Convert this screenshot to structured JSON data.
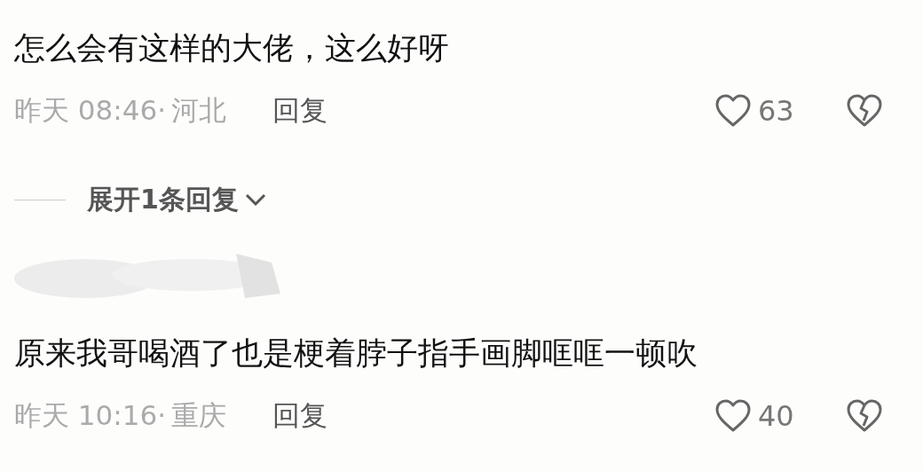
{
  "comments": [
    {
      "text": "怎么会有这样的大佬，这么好呀",
      "time": "昨天 08:46·",
      "location": "河北",
      "reply": "回复",
      "likes": "63",
      "expand": "展开1条回复"
    },
    {
      "text": "原来我哥喝酒了也是梗着脖子指手画脚哐哐一顿吹",
      "time": "昨天 10:16·",
      "location": "重庆",
      "reply": "回复",
      "likes": "40",
      "redacted_author": true
    }
  ]
}
